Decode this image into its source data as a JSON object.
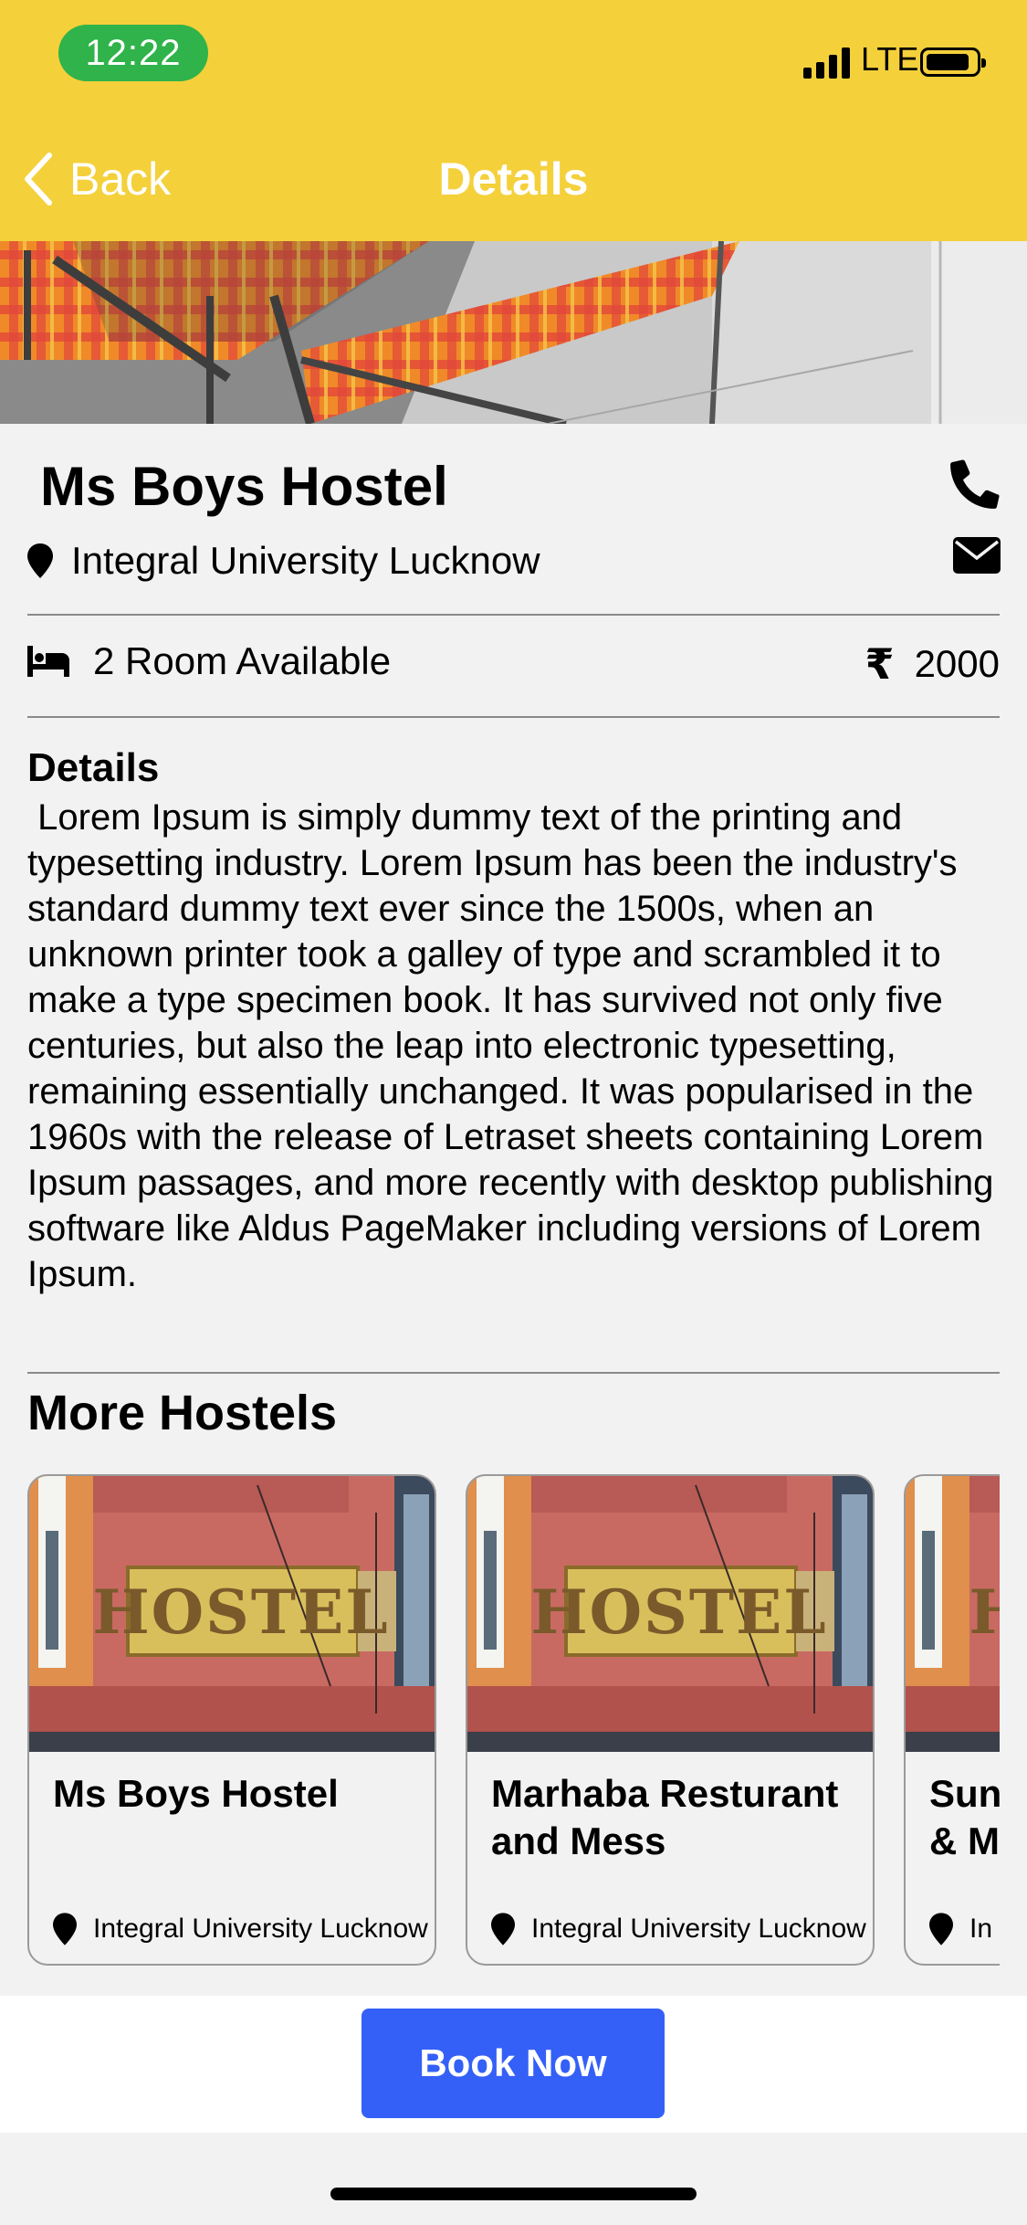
{
  "status_bar": {
    "time": "12:22",
    "network": "LTE"
  },
  "nav": {
    "back_label": "Back",
    "title": "Details"
  },
  "hostel": {
    "name": "Ms Boys Hostel",
    "location": "Integral University Lucknow",
    "rooms": "2 Room Available",
    "currency": "₹",
    "price": "2000"
  },
  "details": {
    "heading": "Details",
    "text": " Lorem Ipsum is simply dummy text of the printing and typesetting industry. Lorem Ipsum has been the industry's standard dummy text ever since the 1500s, when an unknown printer took a galley of type and scrambled it to make a type specimen book. It has survived not only five centuries, but also the leap into electronic typesetting, remaining essentially unchanged. It was popularised in the 1960s with the release of Letraset sheets containing Lorem Ipsum passages, and more recently with desktop publishing software like Aldus PageMaker including versions of Lorem Ipsum."
  },
  "more": {
    "heading": "More Hostels",
    "cards": [
      {
        "name": "Ms Boys Hostel",
        "location": "Integral University Lucknow"
      },
      {
        "name": "Marhaba Resturant and Mess",
        "location": "Integral University Lucknow"
      },
      {
        "name": "Sun\n& M",
        "location": "In"
      }
    ],
    "sign_text": "HOSTEL"
  },
  "actions": {
    "book_now": "Book Now"
  },
  "colors": {
    "header": "#f4d03b",
    "time_pill": "#2fb34a",
    "button": "#3460f7"
  }
}
